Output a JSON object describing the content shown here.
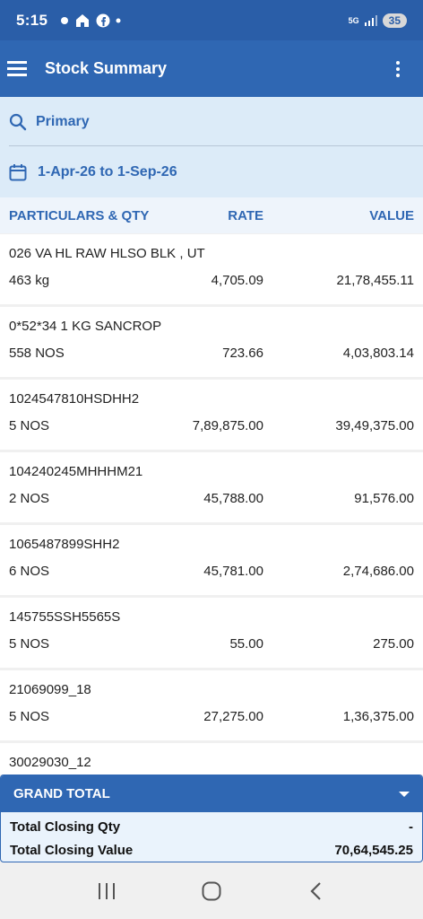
{
  "status": {
    "time": "5:15",
    "network": "5G",
    "battery": "35"
  },
  "app_bar": {
    "title": "Stock Summary"
  },
  "filters": {
    "search_label": "Primary",
    "date_range": "1-Apr-26 to 1-Sep-26"
  },
  "columns": {
    "particulars": "PARTICULARS & QTY",
    "rate": "RATE",
    "value": "VALUE"
  },
  "items": [
    {
      "name": "026 VA HL RAW HLSO BLK , UT",
      "qty": "463 kg",
      "rate": "4,705.09",
      "value": "21,78,455.11"
    },
    {
      "name": "0*52*34 1 KG SANCROP",
      "qty": "558 NOS",
      "rate": "723.66",
      "value": "4,03,803.14"
    },
    {
      "name": "1024547810HSDHH2",
      "qty": "5 NOS",
      "rate": "7,89,875.00",
      "value": "39,49,375.00"
    },
    {
      "name": "104240245MHHHM21",
      "qty": "2 NOS",
      "rate": "45,788.00",
      "value": "91,576.00"
    },
    {
      "name": "1065487899SHH2",
      "qty": "6 NOS",
      "rate": "45,781.00",
      "value": "2,74,686.00"
    },
    {
      "name": "145755SSH5565S",
      "qty": "5 NOS",
      "rate": "55.00",
      "value": "275.00"
    },
    {
      "name": "21069099_18",
      "qty": "5 NOS",
      "rate": "27,275.00",
      "value": "1,36,375.00"
    },
    {
      "name": "30029030_12",
      "qty": "",
      "rate": "",
      "value": ""
    }
  ],
  "grand_total": {
    "title": "GRAND TOTAL",
    "closing_qty_label": "Total Closing Qty",
    "closing_qty_value": "-",
    "closing_value_label": "Total Closing Value",
    "closing_value_value": "70,64,545.25"
  },
  "colors": {
    "primary": "#2f67b3",
    "status_bar": "#2a5ea8",
    "panel": "#dcebf8"
  },
  "icons": [
    "menu-icon",
    "more-vert-icon",
    "search-icon",
    "calendar-icon",
    "chevron-down-icon",
    "recents-icon",
    "home-icon",
    "back-icon"
  ]
}
